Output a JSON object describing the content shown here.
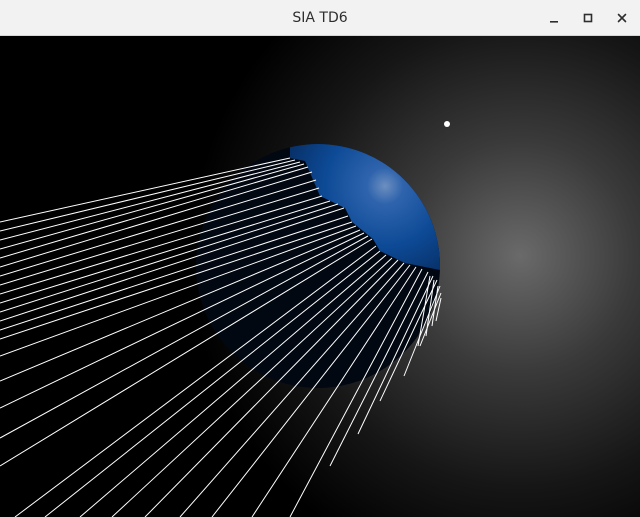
{
  "window": {
    "title": "SIA TD6"
  },
  "titlebar_buttons": {
    "minimize_icon": "minimize-icon",
    "maximize_icon": "maximize-icon",
    "close_icon": "close-icon"
  },
  "scene": {
    "background_color": "#000000",
    "glow_color": "#6a6a6a",
    "sphere_color": "#0d4a96",
    "shadow_color": "#020811",
    "ray_color": "#ffffff",
    "light_color": "#ffffff"
  }
}
